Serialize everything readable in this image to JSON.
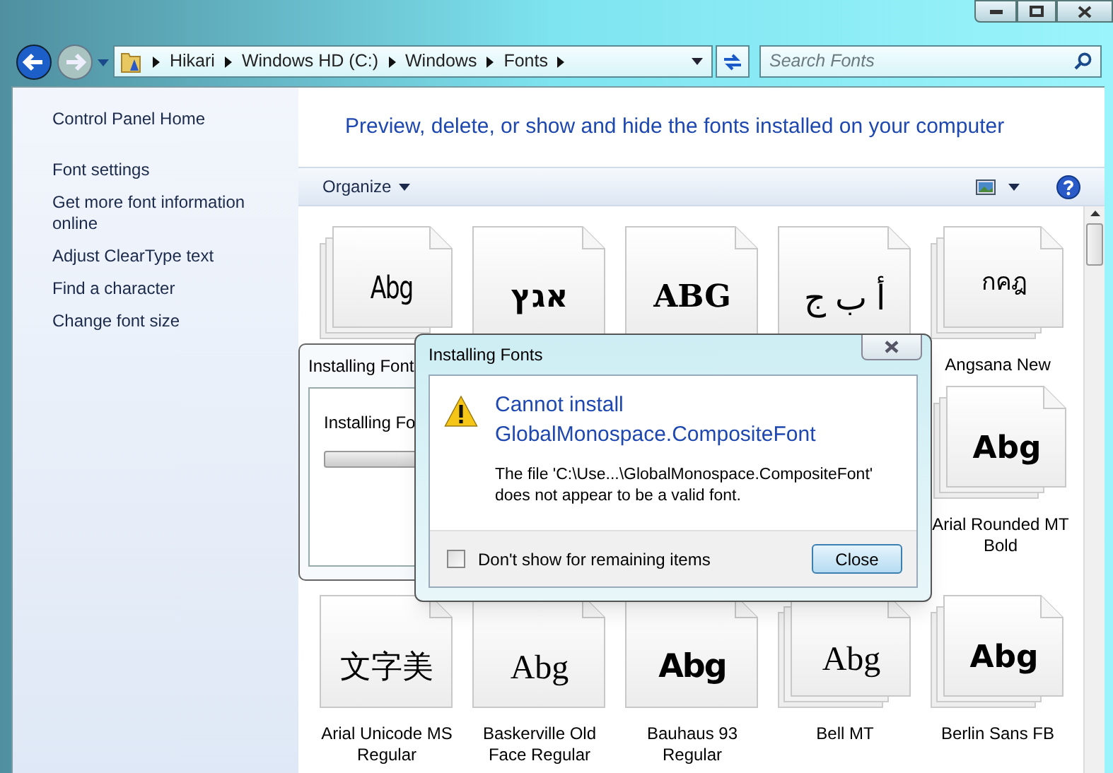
{
  "address_bar": {
    "crumbs": [
      "Hikari",
      "Windows HD (C:)",
      "Windows",
      "Fonts"
    ]
  },
  "search": {
    "placeholder": "Search Fonts"
  },
  "sidebar": {
    "items": [
      {
        "label": "Control Panel Home",
        "kind": "home"
      },
      {
        "label": "Font settings",
        "kind": "task"
      },
      {
        "label": "Get more font information online",
        "kind": "task"
      },
      {
        "label": "Adjust ClearType text",
        "kind": "task"
      },
      {
        "label": "Find a character",
        "kind": "task"
      },
      {
        "label": "Change font size",
        "kind": "task"
      }
    ]
  },
  "header": {
    "title": "Preview, delete, or show and hide the fonts installed on your computer"
  },
  "toolbar": {
    "organize": "Organize"
  },
  "font_rows": [
    [
      {
        "sample": "Abg",
        "stacked": true
      },
      {
        "sample": "אגץ",
        "stacked": false
      },
      {
        "sample": "ABG",
        "stacked": false
      },
      {
        "sample": "أ ب ج",
        "stacked": false
      },
      {
        "sample": "กคฎ",
        "stacked": true,
        "label": "Angsana New"
      }
    ],
    [
      {
        "sample": "Abg",
        "stacked": true,
        "label": "Arial Rounded MT Bold"
      }
    ],
    [
      {
        "sample": "文字美",
        "stacked": false,
        "label": "Arial Unicode MS Regular"
      },
      {
        "sample": "Abg",
        "stacked": false,
        "label": "Baskerville Old Face Regular"
      },
      {
        "sample": "Abg",
        "stacked": false,
        "label": "Bauhaus 93 Regular"
      },
      {
        "sample": "Abg",
        "stacked": true,
        "label": "Bell MT"
      },
      {
        "sample": "Abg",
        "stacked": true,
        "label": "Berlin Sans FB"
      }
    ]
  ],
  "progress_dialog": {
    "title": "Installing Font",
    "message": "Installing Fo",
    "level": 0
  },
  "error_dialog": {
    "title": "Installing Fonts",
    "heading": "Cannot install GlobalMonospace.CompositeFont",
    "message": "The file 'C:\\Use...\\GlobalMonospace.CompositeFont' does not appear to be a valid font.",
    "checkbox": {
      "label": "Don't show for remaining items",
      "checked": false
    },
    "button": "Close"
  }
}
